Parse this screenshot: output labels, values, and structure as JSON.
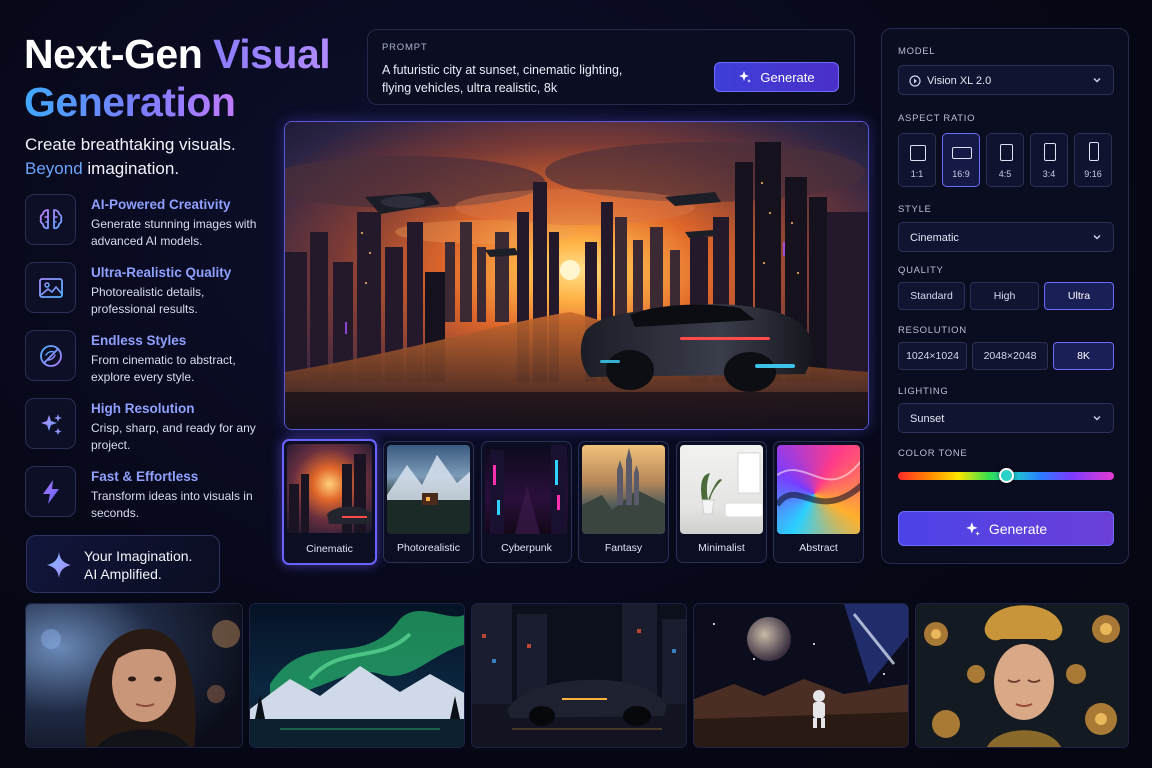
{
  "hero": {
    "title_line1_a": "Next-Gen ",
    "title_line1_b": "Visual",
    "title_line2": "Generation",
    "subtitle_line1": "Create breathtaking visuals.",
    "subtitle_accent": "Beyond",
    "subtitle_rest": " imagination."
  },
  "features": [
    {
      "title": "AI-Powered Creativity",
      "desc": "Generate stunning images with advanced AI models.",
      "icon": "brain-icon"
    },
    {
      "title": "Ultra-Realistic Quality",
      "desc": "Photorealistic details, professional results.",
      "icon": "image-icon"
    },
    {
      "title": "Endless Styles",
      "desc": "From cinematic to abstract, explore every style.",
      "icon": "palette-icon"
    },
    {
      "title": "High Resolution",
      "desc": "Crisp, sharp, and ready for any project.",
      "icon": "sparkles-icon"
    },
    {
      "title": "Fast & Effortless",
      "desc": "Transform ideas into visuals in seconds.",
      "icon": "lightning-icon"
    }
  ],
  "tagline": {
    "line1": "Your Imagination.",
    "line2": "AI Amplified."
  },
  "prompt": {
    "label": "PROMPT",
    "text": "A futuristic city at sunset, cinematic lighting, flying vehicles, ultra realistic, 8k",
    "button": "Generate"
  },
  "thumbs": [
    {
      "label": "Cinematic",
      "selected": true
    },
    {
      "label": "Photorealistic",
      "selected": false
    },
    {
      "label": "Cyberpunk",
      "selected": false
    },
    {
      "label": "Fantasy",
      "selected": false
    },
    {
      "label": "Minimalist",
      "selected": false
    },
    {
      "label": "Abstract",
      "selected": false
    }
  ],
  "panel": {
    "model_label": "MODEL",
    "model_value": "Vision XL 2.0",
    "aspect_label": "ASPECT RATIO",
    "aspect_ratios": [
      "1:1",
      "16:9",
      "4:5",
      "3:4",
      "9:16"
    ],
    "aspect_selected": "16:9",
    "style_label": "STYLE",
    "style_value": "Cinematic",
    "quality_label": "QUALITY",
    "quality_options": [
      "Standard",
      "High",
      "Ultra"
    ],
    "quality_selected": "Ultra",
    "resolution_label": "RESOLUTION",
    "resolution_options": [
      "1024×1024",
      "2048×2048",
      "8K"
    ],
    "resolution_selected": "8K",
    "lighting_label": "LIGHTING",
    "lighting_value": "Sunset",
    "tone_label": "COLOR TONE",
    "tone_position": 0.5,
    "generate_button": "Generate"
  },
  "colors": {
    "accent": "#6a62ff",
    "accent_blue": "#3fa9ff",
    "bg": "#070818"
  }
}
